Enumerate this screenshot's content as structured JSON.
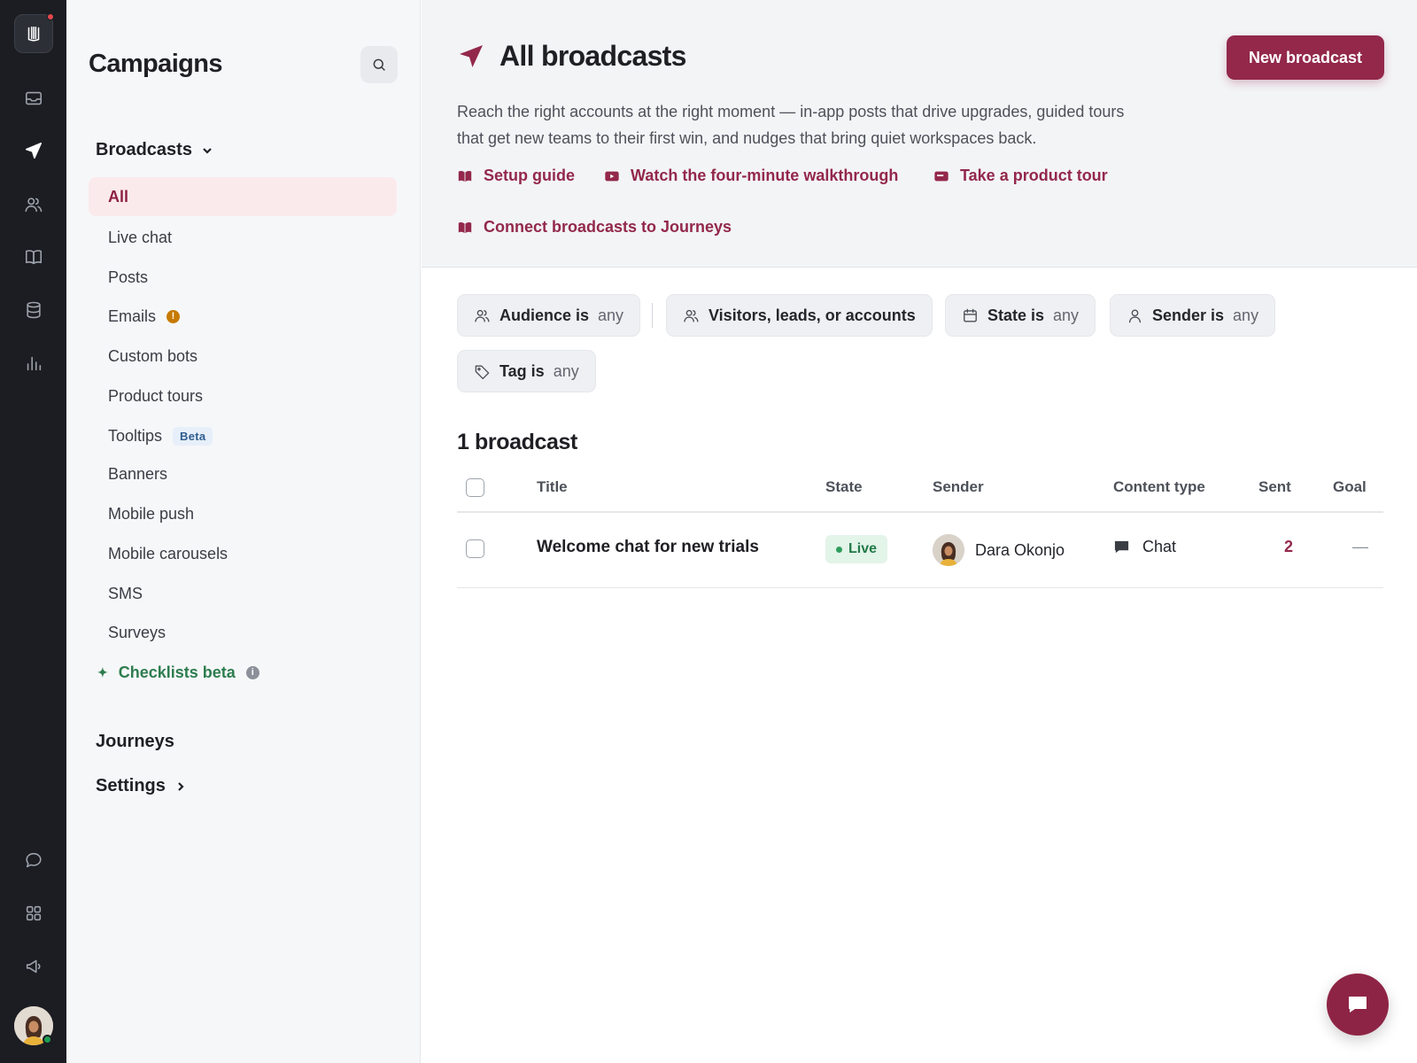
{
  "colors": {
    "accent": "#93284b",
    "rail_bg": "#1b1d22",
    "live": "#227a48"
  },
  "rail": {
    "logo_icon": "app-logo-icon",
    "items": [
      {
        "icon": "inbox-icon"
      },
      {
        "icon": "send-icon",
        "active": true
      },
      {
        "icon": "contacts-icon"
      },
      {
        "icon": "book-icon"
      },
      {
        "icon": "database-icon"
      },
      {
        "icon": "bar-chart-icon"
      }
    ],
    "bottom_items": [
      {
        "icon": "chat-bubble-icon"
      },
      {
        "icon": "grid-apps-icon"
      },
      {
        "icon": "megaphone-icon"
      }
    ]
  },
  "sidebar": {
    "title": "Campaigns",
    "broadcasts_label": "Broadcasts",
    "items": [
      {
        "label": "All"
      },
      {
        "label": "Live chat"
      },
      {
        "label": "Posts"
      },
      {
        "label": "Emails",
        "badge": "!"
      },
      {
        "label": "Custom bots"
      },
      {
        "label": "Product tours"
      },
      {
        "label": "Tooltips",
        "badge": "Beta"
      },
      {
        "label": "Banners"
      },
      {
        "label": "Mobile push"
      },
      {
        "label": "Mobile carousels"
      },
      {
        "label": "SMS"
      },
      {
        "label": "Surveys"
      },
      {
        "label": "Checklists beta",
        "badge": "i"
      }
    ],
    "journeys_label": "Journeys",
    "settings_label": "Settings"
  },
  "header": {
    "title": "All broadcasts",
    "new_button": "New broadcast",
    "description": "Reach the right accounts at the right moment — in-app posts that drive upgrades, guided tours that get new teams to their first win, and nudges that bring quiet workspaces back.",
    "links": [
      {
        "label": "Setup guide",
        "icon": "book-icon"
      },
      {
        "label": "Watch the four-minute walkthrough",
        "icon": "video-icon"
      },
      {
        "label": "Take a product tour",
        "icon": "tour-icon"
      },
      {
        "label": "Connect broadcasts to Journeys",
        "icon": "book-icon"
      }
    ]
  },
  "filters": [
    {
      "key": "Audience is",
      "value": "any",
      "icon": "people-icon"
    },
    {
      "key": "Visitors, leads, or accounts",
      "value": "",
      "icon": "people-icon"
    },
    {
      "key": "State is",
      "value": "any",
      "icon": "calendar-icon"
    },
    {
      "key": "Sender is",
      "value": "any",
      "icon": "person-icon"
    },
    {
      "key": "Tag is",
      "value": "any",
      "icon": "tag-icon"
    }
  ],
  "results": {
    "count_label": "1 broadcast",
    "columns": [
      "Title",
      "State",
      "Sender",
      "Content type",
      "Sent",
      "Goal"
    ],
    "rows": [
      {
        "title": "Welcome chat for new trials",
        "state": "Live",
        "sender": "Dara Okonjo",
        "content_type": "Chat",
        "sent": "2",
        "goal": "—"
      }
    ]
  }
}
